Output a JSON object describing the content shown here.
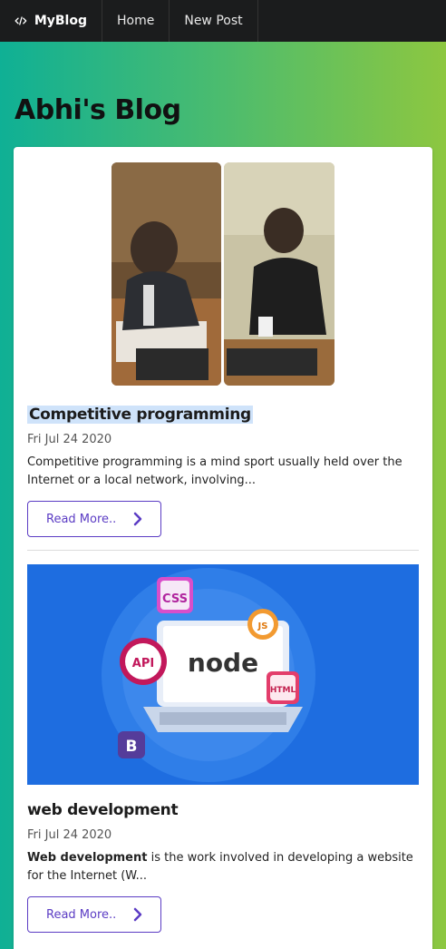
{
  "nav": {
    "brand": "MyBlog",
    "items": [
      "Home",
      "New Post"
    ]
  },
  "page": {
    "title": "Abhi's Blog"
  },
  "posts": [
    {
      "title": "Competitive programming",
      "date": "Fri Jul 24 2020",
      "excerpt": "Competitive programming is a mind sport usually held over the Internet or a local network, involving...",
      "button": "Read More.."
    },
    {
      "title": "web development",
      "date": "Fri Jul 24 2020",
      "excerpt_bold": "Web development",
      "excerpt_rest": " is the work involved in developing a website for the Internet (W...",
      "button": "Read More..",
      "image_labels": {
        "css": "CSS",
        "js": "JS",
        "api": "API",
        "node": "node",
        "html": "HTML",
        "bootstrap": "B"
      }
    }
  ],
  "colors": {
    "accent": "#5b3cc4",
    "navbar": "#1b1c1d",
    "highlight": "#cfe3fa"
  }
}
